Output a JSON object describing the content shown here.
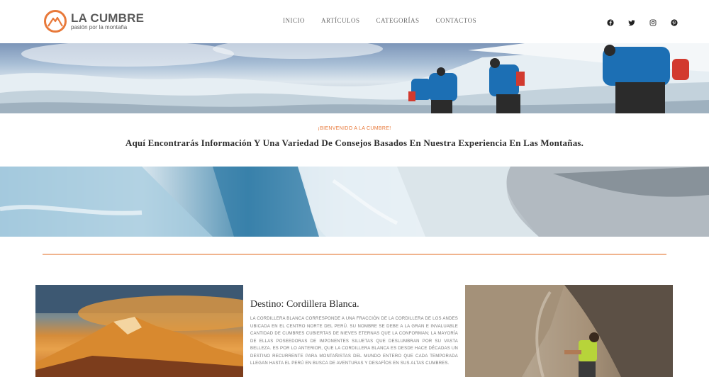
{
  "header": {
    "logo_title": "LA CUMBRE",
    "logo_subtitle": "pasión por la montaña",
    "nav": [
      "INICIO",
      "ARTÍCULOS",
      "CATEGORÍAS",
      "CONTACTOS"
    ],
    "social_icons": [
      "facebook-icon",
      "twitter-icon",
      "instagram-icon",
      "pinterest-icon"
    ]
  },
  "welcome": {
    "kicker": "¡BIENVENIDO A LA CUMBRE!",
    "title": "Aquí Encontrarás Información Y Una Variedad De Consejos Basados En Nuestra Experiencia En Las Montañas."
  },
  "destination": {
    "title": "Destino: Cordillera Blanca.",
    "text": "LA CORDILLERA BLANCA CORRESPONDE A UNA FRACCIÓN DE LA CORDILLERA DE LOS ANDES UBICADA EN EL CENTRO NORTE DEL PERÚ. SU NOMBRE SE DEBE A LA GRAN E INVALUABLE CANTIDAD DE CUMBRES CUBIERTAS DE NIEVES ETERNAS QUE LA CONFORMAN; LA MAYORÍA DE ELLAS POSEEDORAS DE IMPONENTES SILUETAS QUE DESLUMBRAN POR SU VASTA BELLEZA. ES POR LO ANTERIOR, QUE LA CORDILLERA BLANCA ES DESDE HACE DÉCADAS UN DESTINO RECURRENTE PARA MONTAÑISTAS DEL MUNDO ENTERO QUE CADA TEMPORADA LLEGAN HASTA EL PERÚ EN BUSCA DE AVENTURAS Y DESAFÍOS EN SUS ALTAS CUMBRES."
  },
  "colors": {
    "accent": "#e8793a",
    "divider": "#f0b48e",
    "nav_text": "#6a6a6a"
  }
}
